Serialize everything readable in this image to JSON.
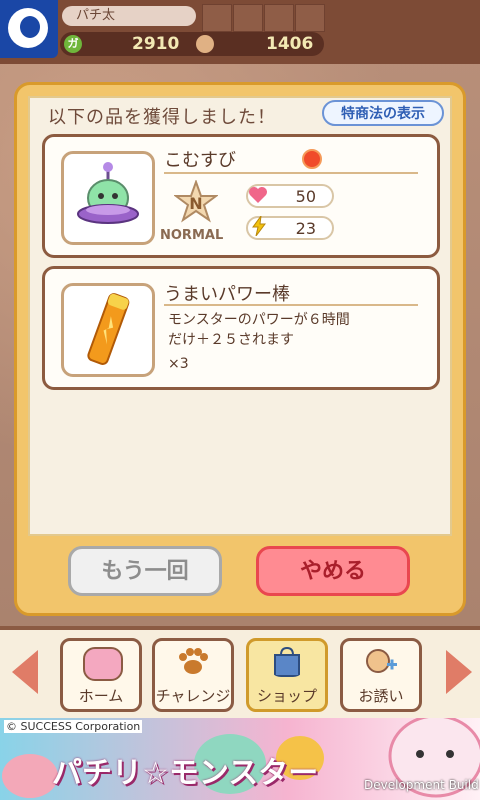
{
  "header": {
    "player_name": "パチ太",
    "coin_icon_text": "ガ",
    "coins": "2910",
    "monster_points": "1406"
  },
  "modal": {
    "title": "以下の品を獲得しました！",
    "law_button": "特商法の表示",
    "items": [
      {
        "name": "こむすび",
        "rank_letter": "N",
        "rank_label": "NORMAL",
        "stats": {
          "hp": "50",
          "power": "23"
        }
      },
      {
        "name": "うまいパワー棒",
        "description_line1": "モンスターのパワーが６時間",
        "description_line2": "だけ＋２５されます",
        "quantity": "×3"
      }
    ],
    "again_button": "もう一回",
    "quit_button": "やめる"
  },
  "nav": {
    "items": [
      {
        "label": "ホーム",
        "icon": "home-blob-icon"
      },
      {
        "label": "チャレンジ",
        "icon": "paw-icon"
      },
      {
        "label": "ショップ",
        "icon": "shopping-bag-icon"
      },
      {
        "label": "お誘い",
        "icon": "invite-character-icon"
      }
    ]
  },
  "banner": {
    "copyright": "© SUCCESS Corporation",
    "logo_text": "パチリ☆モンスター",
    "dev_build": "Development Build"
  },
  "colors": {
    "accent_red": "#e9474f",
    "frame_gold": "#d99a2b",
    "brown": "#8c5b40"
  }
}
